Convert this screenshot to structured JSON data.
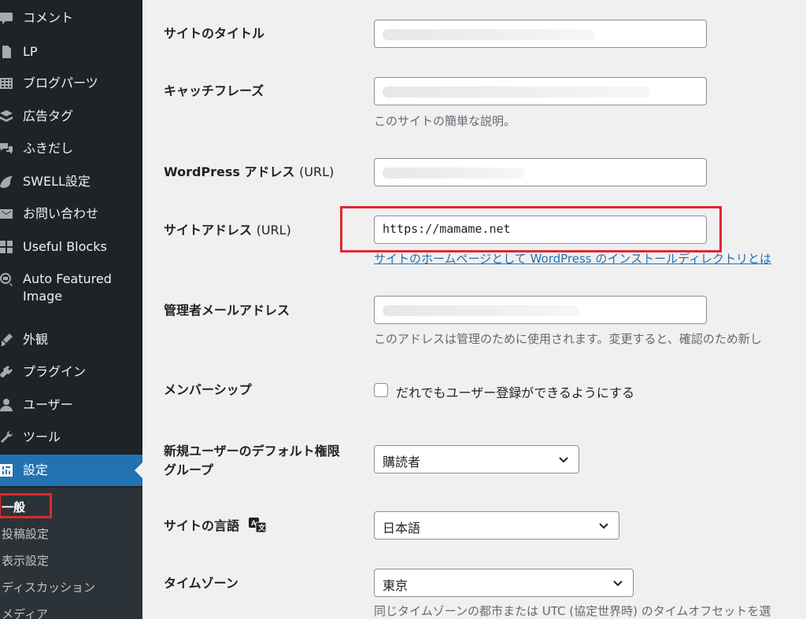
{
  "sidebar": {
    "items": [
      {
        "label": "コメント",
        "icon": "comment-icon"
      },
      {
        "label": "LP",
        "icon": "page-icon"
      },
      {
        "label": "ブログパーツ",
        "icon": "grid-icon"
      },
      {
        "label": "広告タグ",
        "icon": "ad-tag-icon"
      },
      {
        "label": "ふきだし",
        "icon": "speech-bubble-icon"
      },
      {
        "label": "SWELL設定",
        "icon": "swell-icon"
      },
      {
        "label": "お問い合わせ",
        "icon": "mail-icon"
      },
      {
        "label": "Useful Blocks",
        "icon": "blocks-icon"
      },
      {
        "label": "Auto Featured Image",
        "icon": "image-search-icon"
      },
      {
        "label": "外観",
        "icon": "brush-icon"
      },
      {
        "label": "プラグイン",
        "icon": "plugin-icon"
      },
      {
        "label": "ユーザー",
        "icon": "user-icon"
      },
      {
        "label": "ツール",
        "icon": "wrench-icon"
      },
      {
        "label": "設定",
        "icon": "settings-icon"
      }
    ],
    "submenu": [
      "一般",
      "投稿設定",
      "表示設定",
      "ディスカッション",
      "メディア"
    ]
  },
  "form": {
    "site_title_label": "サイトのタイトル",
    "tagline_label": "キャッチフレーズ",
    "tagline_desc": "このサイトの簡単な説明。",
    "wp_address_label_main": "WordPress アドレス",
    "wp_address_label_suffix": "(URL)",
    "site_address_label_main": "サイトアドレス",
    "site_address_label_suffix": "(URL)",
    "site_address_value": "https://mamame.net",
    "site_address_desc": "サイトのホームページとして WordPress のインストールディレクトリとは",
    "admin_email_label": "管理者メールアドレス",
    "admin_email_desc": "このアドレスは管理のために使用されます。変更すると、確認のため新し",
    "membership_label": "メンバーシップ",
    "membership_checkbox": "だれでもユーザー登録ができるようにする",
    "default_role_label_line1": "新規ユーザーのデフォルト権限",
    "default_role_label_line2": "グループ",
    "default_role_value": "購読者",
    "site_language_label": "サイトの言語",
    "site_language_value": "日本語",
    "timezone_label": "タイムゾーン",
    "timezone_value": "東京",
    "timezone_desc": "同じタイムゾーンの都市または UTC (協定世界時) のタイムオフセットを選"
  },
  "colors": {
    "sidebar_bg": "#1d2327",
    "accent": "#2271b1",
    "highlight_box": "#e0282e"
  }
}
